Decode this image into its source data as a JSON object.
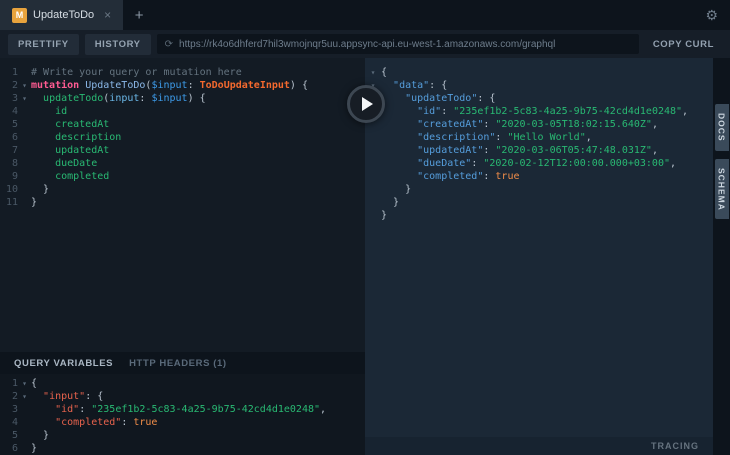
{
  "colors": {
    "tab_icon": "#e8a33d",
    "comment": "#64737f",
    "keyword": "#ff5b92",
    "opname": "#8bb8e8",
    "variable": "#3d9be9",
    "typename": "#f4692e",
    "field": "#29b973",
    "argname": "#6bb8e8",
    "punct": "#b9c4cf",
    "json_key": "#559ddb",
    "json_string": "#29b973",
    "json_bool": "#f08d49",
    "vars_key": "#e8634d",
    "line_number": "#4a5866"
  },
  "tab_bar": {
    "tab": {
      "icon_letter": "M",
      "title": "UpdateToDo",
      "close_glyph": "×"
    },
    "new_tab_glyph": "+",
    "gear_glyph": "⚙"
  },
  "toolbar": {
    "prettify_label": "PRETTIFY",
    "history_label": "HISTORY",
    "url_icon_glyph": "⟳",
    "url": "https://rk4o6dhferd7hil3wmojnqr5uu.appsync-api.eu-west-1.amazonaws.com/graphql",
    "copy_curl_label": "COPY CURL"
  },
  "query_editor": {
    "lines": [
      {
        "n": 1,
        "tokens": [
          {
            "c": "cm",
            "s": "# Write your query or mutation here"
          }
        ]
      },
      {
        "n": 2,
        "fold": true,
        "tokens": [
          {
            "c": "kw",
            "s": "mutation "
          },
          {
            "c": "def",
            "s": "UpdateToDo"
          },
          {
            "c": "pn",
            "s": "("
          },
          {
            "c": "var",
            "s": "$input"
          },
          {
            "c": "pn",
            "s": ": "
          },
          {
            "c": "type",
            "s": "ToDoUpdateInput"
          },
          {
            "c": "pn",
            "s": ") {"
          }
        ]
      },
      {
        "n": 3,
        "fold": true,
        "tokens": [
          {
            "c": "pn",
            "s": "  "
          },
          {
            "c": "field",
            "s": "updateTodo"
          },
          {
            "c": "pn",
            "s": "("
          },
          {
            "c": "attr",
            "s": "input"
          },
          {
            "c": "pn",
            "s": ": "
          },
          {
            "c": "var",
            "s": "$input"
          },
          {
            "c": "pn",
            "s": ") {"
          }
        ]
      },
      {
        "n": 4,
        "tokens": [
          {
            "c": "field",
            "s": "    id"
          }
        ]
      },
      {
        "n": 5,
        "tokens": [
          {
            "c": "field",
            "s": "    createdAt"
          }
        ]
      },
      {
        "n": 6,
        "tokens": [
          {
            "c": "field",
            "s": "    description"
          }
        ]
      },
      {
        "n": 7,
        "tokens": [
          {
            "c": "field",
            "s": "    updatedAt"
          }
        ]
      },
      {
        "n": 8,
        "tokens": [
          {
            "c": "field",
            "s": "    dueDate"
          }
        ]
      },
      {
        "n": 9,
        "tokens": [
          {
            "c": "field",
            "s": "    completed"
          }
        ]
      },
      {
        "n": 10,
        "tokens": [
          {
            "c": "pn",
            "s": "  }"
          }
        ]
      },
      {
        "n": 11,
        "tokens": [
          {
            "c": "pn",
            "s": "}"
          }
        ]
      }
    ]
  },
  "response_viewer": {
    "lines": [
      {
        "fold": true,
        "tokens": [
          {
            "c": "pn",
            "s": "{"
          }
        ]
      },
      {
        "fold": true,
        "tokens": [
          {
            "c": "pn",
            "s": "  "
          },
          {
            "c": "key",
            "s": "\"data\""
          },
          {
            "c": "pn",
            "s": ": {"
          }
        ]
      },
      {
        "fold": true,
        "tokens": [
          {
            "c": "pn",
            "s": "    "
          },
          {
            "c": "key",
            "s": "\"updateTodo\""
          },
          {
            "c": "pn",
            "s": ": {"
          }
        ]
      },
      {
        "tokens": [
          {
            "c": "pn",
            "s": "      "
          },
          {
            "c": "key",
            "s": "\"id\""
          },
          {
            "c": "pn",
            "s": ": "
          },
          {
            "c": "str",
            "s": "\"235ef1b2-5c83-4a25-9b75-42cd4d1e0248\""
          },
          {
            "c": "pn",
            "s": ","
          }
        ]
      },
      {
        "tokens": [
          {
            "c": "pn",
            "s": "      "
          },
          {
            "c": "key",
            "s": "\"createdAt\""
          },
          {
            "c": "pn",
            "s": ": "
          },
          {
            "c": "str",
            "s": "\"2020-03-05T18:02:15.640Z\""
          },
          {
            "c": "pn",
            "s": ","
          }
        ]
      },
      {
        "tokens": [
          {
            "c": "pn",
            "s": "      "
          },
          {
            "c": "key",
            "s": "\"description\""
          },
          {
            "c": "pn",
            "s": ": "
          },
          {
            "c": "str",
            "s": "\"Hello World\""
          },
          {
            "c": "pn",
            "s": ","
          }
        ]
      },
      {
        "tokens": [
          {
            "c": "pn",
            "s": "      "
          },
          {
            "c": "key",
            "s": "\"updatedAt\""
          },
          {
            "c": "pn",
            "s": ": "
          },
          {
            "c": "str",
            "s": "\"2020-03-06T05:47:48.031Z\""
          },
          {
            "c": "pn",
            "s": ","
          }
        ]
      },
      {
        "tokens": [
          {
            "c": "pn",
            "s": "      "
          },
          {
            "c": "key",
            "s": "\"dueDate\""
          },
          {
            "c": "pn",
            "s": ": "
          },
          {
            "c": "str",
            "s": "\"2020-02-12T12:00:00.000+03:00\""
          },
          {
            "c": "pn",
            "s": ","
          }
        ]
      },
      {
        "tokens": [
          {
            "c": "pn",
            "s": "      "
          },
          {
            "c": "key",
            "s": "\"completed\""
          },
          {
            "c": "pn",
            "s": ": "
          },
          {
            "c": "bool",
            "s": "true"
          }
        ]
      },
      {
        "tokens": [
          {
            "c": "pn",
            "s": "    }"
          }
        ]
      },
      {
        "tokens": [
          {
            "c": "pn",
            "s": "  }"
          }
        ]
      },
      {
        "tokens": [
          {
            "c": "pn",
            "s": "}"
          }
        ]
      }
    ]
  },
  "variables_panel": {
    "query_variables_label": "QUERY VARIABLES",
    "http_headers_label": "HTTP HEADERS (1)",
    "lines": [
      {
        "n": 1,
        "fold": true,
        "tokens": [
          {
            "c": "pn",
            "s": "{"
          }
        ]
      },
      {
        "n": 2,
        "fold": true,
        "tokens": [
          {
            "c": "pn",
            "s": "  "
          },
          {
            "c": "vkey",
            "s": "\"input\""
          },
          {
            "c": "pn",
            "s": ": {"
          }
        ]
      },
      {
        "n": 3,
        "tokens": [
          {
            "c": "pn",
            "s": "    "
          },
          {
            "c": "vkey",
            "s": "\"id\""
          },
          {
            "c": "pn",
            "s": ": "
          },
          {
            "c": "str",
            "s": "\"235ef1b2-5c83-4a25-9b75-42cd4d1e0248\""
          },
          {
            "c": "pn",
            "s": ","
          }
        ]
      },
      {
        "n": 4,
        "tokens": [
          {
            "c": "pn",
            "s": "    "
          },
          {
            "c": "vkey",
            "s": "\"completed\""
          },
          {
            "c": "pn",
            "s": ": "
          },
          {
            "c": "bool",
            "s": "true"
          }
        ]
      },
      {
        "n": 5,
        "tokens": [
          {
            "c": "pn",
            "s": "  }"
          }
        ]
      },
      {
        "n": 6,
        "tokens": [
          {
            "c": "pn",
            "s": "}"
          }
        ]
      }
    ]
  },
  "side_tabs": [
    {
      "label": "DOCS"
    },
    {
      "label": "SCHEMA"
    }
  ],
  "tracing_label": "TRACING"
}
